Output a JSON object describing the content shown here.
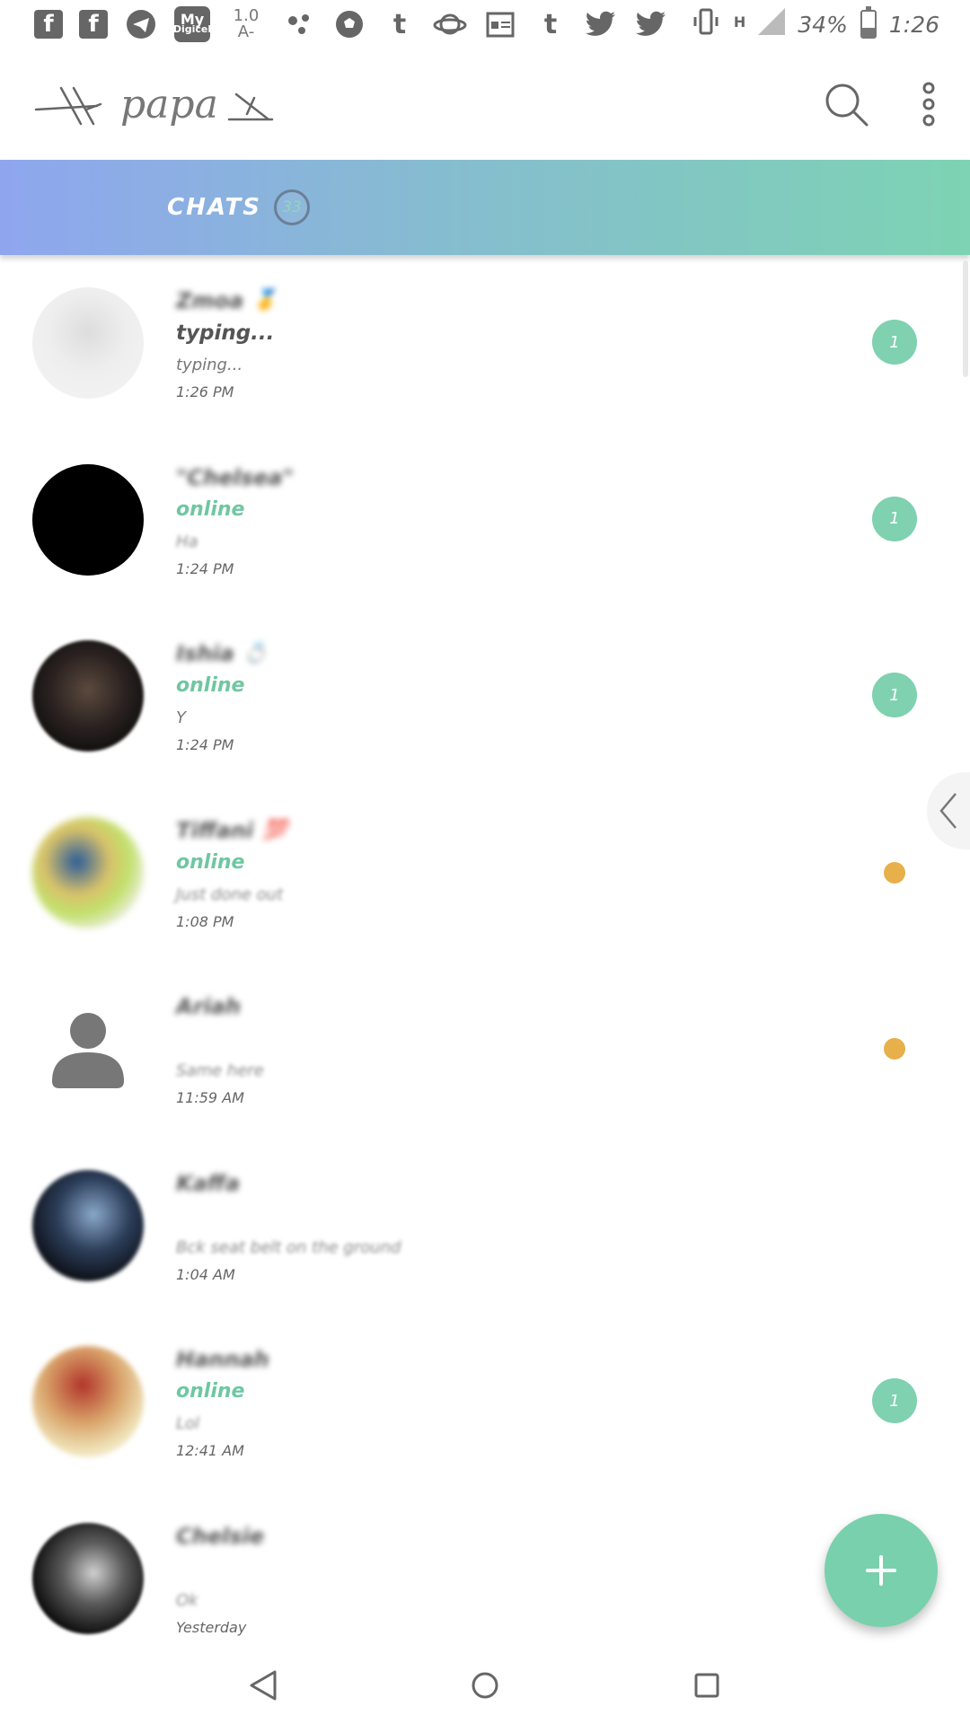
{
  "status_bar": {
    "left_icons": [
      "facebook-icon",
      "facebook-icon",
      "telegram-icon",
      "my-digicel-icon",
      "data-speed-indicator",
      "dots-icon",
      "soccer-ball-icon",
      "tumblr-icon",
      "planet-icon",
      "calendar-news-icon",
      "tumblr-icon",
      "twitter-icon",
      "twitter-icon"
    ],
    "mydigicel_top": "My",
    "mydigicel_bottom": "Digicel",
    "speed_value": "1.0",
    "speed_unit": "A-",
    "network_type": "H",
    "battery": "34%",
    "battery_level": 0.34,
    "time": "1:26"
  },
  "app_bar": {
    "title": "papa",
    "actions": [
      "search-icon",
      "more-vert-icon"
    ]
  },
  "tabs": [
    {
      "label": "CHATS",
      "count": "33"
    }
  ],
  "colors": {
    "accent_green": "#7fd1b0",
    "online_green": "#6fc7a2",
    "unread_dot": "#e8b04a",
    "gradient_start": "#8fa6ef",
    "gradient_end": "#7dd3b3"
  },
  "chats": [
    {
      "name": "Zmoa",
      "emoji": "🥇",
      "status": "typing...",
      "status_type": "typing",
      "preview": "typing...",
      "preview_blur": false,
      "time": "1:26 PM",
      "badge": "1",
      "indicator": "badge",
      "avatar": "illustration"
    },
    {
      "name": "\"Chelsea\"",
      "emoji": "",
      "status": "online",
      "status_type": "online",
      "preview": "Ha",
      "preview_blur": true,
      "time": "1:24 PM",
      "badge": "1",
      "indicator": "badge",
      "avatar": "black"
    },
    {
      "name": "Ishia",
      "emoji": "💍",
      "status": "online",
      "status_type": "online",
      "preview": "Y",
      "preview_blur": false,
      "time": "1:24 PM",
      "badge": "1",
      "indicator": "badge",
      "avatar": "dark-photo"
    },
    {
      "name": "Tiffani",
      "emoji": "💯",
      "status": "online",
      "status_type": "online",
      "preview": "Just done out",
      "preview_blur": true,
      "time": "1:08 PM",
      "badge": "",
      "indicator": "dot",
      "avatar": "colorful-photo"
    },
    {
      "name": "Ariah",
      "emoji": "",
      "status": "",
      "status_type": "none",
      "preview": "Same here",
      "preview_blur": true,
      "time": "11:59 AM",
      "badge": "",
      "indicator": "dot",
      "avatar": "placeholder"
    },
    {
      "name": "Kaffa",
      "emoji": "",
      "status": "",
      "status_type": "none",
      "preview": "Bck seat belt on the ground",
      "preview_blur": true,
      "time": "1:04 AM",
      "badge": "",
      "indicator": "none",
      "avatar": "night-photo"
    },
    {
      "name": "Hannah",
      "emoji": "",
      "status": "online",
      "status_type": "online",
      "preview": "Lol",
      "preview_blur": true,
      "time": "12:41 AM",
      "badge": "1",
      "indicator": "badge",
      "avatar": "warm-photo"
    },
    {
      "name": "Chelsie",
      "emoji": "",
      "status": "",
      "status_type": "none",
      "preview": "Ok",
      "preview_blur": true,
      "time": "Yesterday",
      "badge": "",
      "indicator": "none",
      "avatar": "bw-photo"
    }
  ],
  "fab": {
    "icon": "plus-icon"
  },
  "nav_bar": {
    "buttons": [
      "back-icon",
      "home-icon",
      "recents-icon"
    ]
  }
}
